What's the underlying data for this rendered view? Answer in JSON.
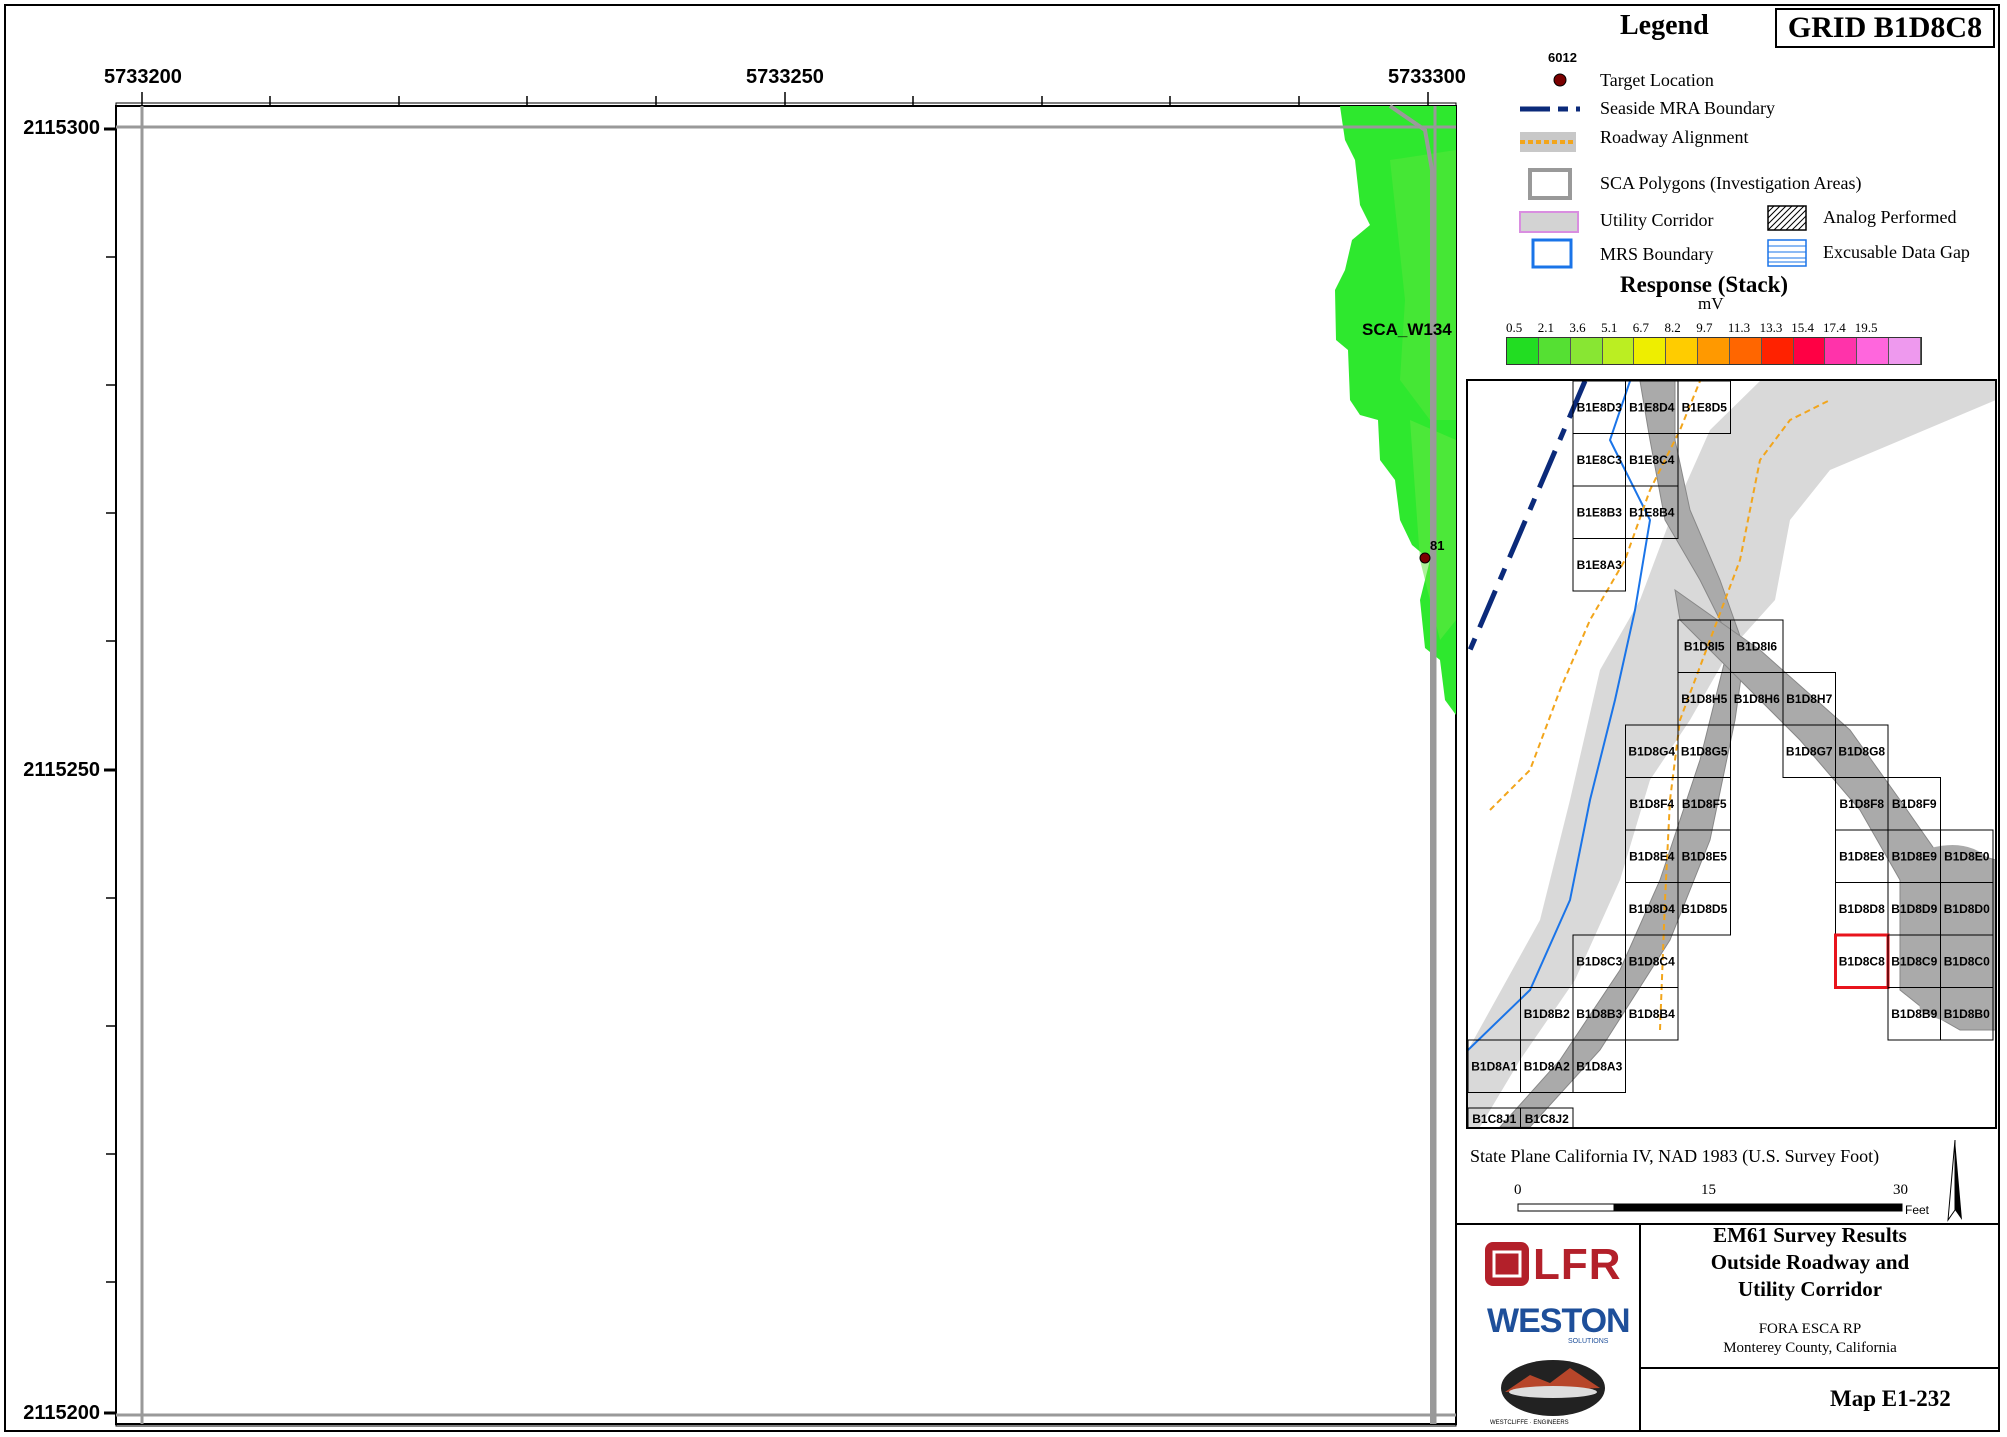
{
  "map": {
    "x_ticks": [
      "5733200",
      "5733250",
      "5733300"
    ],
    "y_ticks": [
      "2115300",
      "2115250",
      "2115200"
    ],
    "sca_label": "SCA_W134",
    "target_label": "81"
  },
  "legend": {
    "title": "Legend",
    "grid_id": "GRID B1D8C8",
    "target_number": "6012",
    "items": {
      "target": "Target Location",
      "mra": "Seaside MRA Boundary",
      "roadway": "Roadway Alignment",
      "sca": "SCA Polygons (Investigation Areas)",
      "utility": "Utility Corridor",
      "analog": "Analog Performed",
      "mrs": "MRS Boundary",
      "gap": "Excusable Data Gap"
    },
    "response_title": "Response (Stack)",
    "response_unit": "mV",
    "scale_values": [
      "0.5",
      "2.1",
      "3.6",
      "5.1",
      "6.7",
      "8.2",
      "9.7",
      "11.3",
      "13.3",
      "15.4",
      "17.4",
      "19.5"
    ],
    "colors": [
      "#22dd22",
      "#55e033",
      "#88e633",
      "#bbee22",
      "#eeee00",
      "#ffcc00",
      "#ff9900",
      "#ff6600",
      "#ff2200",
      "#ff0044",
      "#ff33aa",
      "#ff66dd",
      "#ee99ee"
    ]
  },
  "index_map": {
    "grid_cells": [
      "B1E8D3",
      "B1E8D4",
      "B1E8D5",
      "B1E8C3",
      "B1E8C4",
      "B1E8B3",
      "B1E8B4",
      "B1E8A3",
      "B1D8I5",
      "B1D8I6",
      "B1D8H5",
      "B1D8H6",
      "B1D8H7",
      "B1D8G4",
      "B1D8G5",
      "B1D8G7",
      "B1D8G8",
      "B1D8F4",
      "B1D8F5",
      "B1D8F8",
      "B1D8F9",
      "B1D8E4",
      "B1D8E5",
      "B1D8E8",
      "B1D8E9",
      "B1D8E0",
      "B1D8D4",
      "B1D8D5",
      "B1D8D8",
      "B1D8D9",
      "B1D8D0",
      "B1D8C3",
      "B1D8C4",
      "B1D8C8",
      "B1D8C9",
      "B1D8C0",
      "B1D8B2",
      "B1D8B3",
      "B1D8B4",
      "B1D8B9",
      "B1D8B0",
      "B1D8A1",
      "B1D8A2",
      "B1D8A3",
      "B1C8J1",
      "B1C8J2"
    ],
    "highlight": "B1D8C8"
  },
  "scale_bar": {
    "projection": "State Plane California IV, NAD 1983 (U.S. Survey Foot)",
    "labels": [
      "0",
      "15",
      "30"
    ],
    "unit": "Feet"
  },
  "title_block": {
    "title_lines": [
      "EM61 Survey Results",
      "Outside Roadway and",
      "Utility Corridor"
    ],
    "project": "FORA ESCA RP",
    "location": "Monterey County, California",
    "map_number": "Map E1-232",
    "logo_lfr": "LFR",
    "logo_weston": "WESTON",
    "logo_weston_sub": "SOLUTIONS",
    "logo_westcliffe": "WESTCLIFFE · ENGINEERS"
  }
}
